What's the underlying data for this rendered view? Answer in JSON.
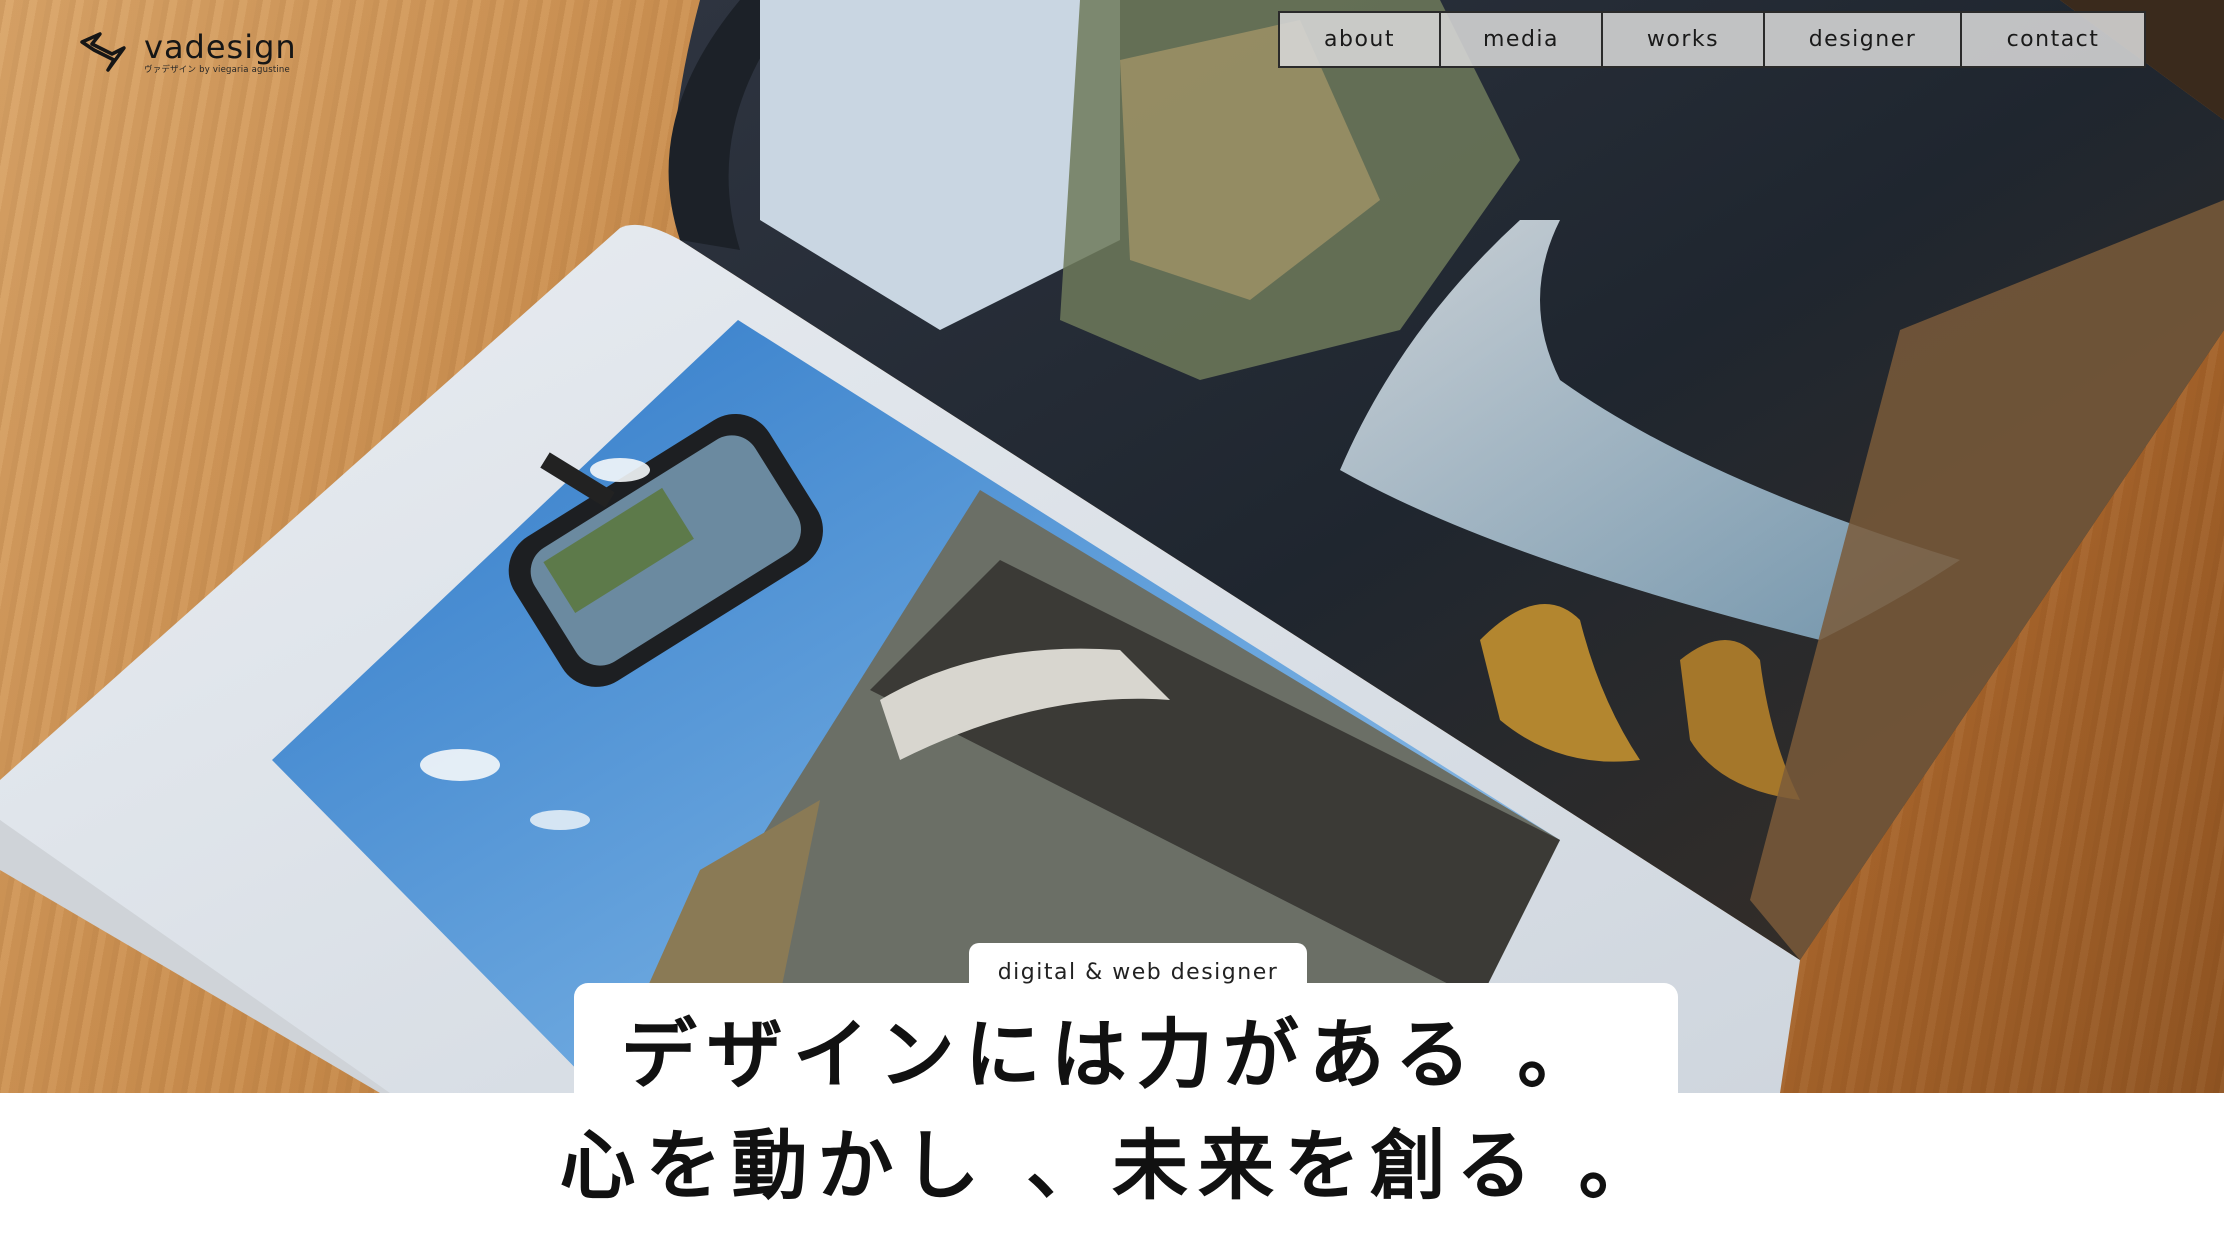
{
  "brand": {
    "name": "vadesign",
    "subtitle": "ヴァデザイン by viegaria agustine",
    "logo_icon": "vadesign-logo-mark"
  },
  "nav": {
    "items": [
      {
        "label": "about"
      },
      {
        "label": "media"
      },
      {
        "label": "works"
      },
      {
        "label": "designer"
      },
      {
        "label": "contact"
      }
    ]
  },
  "hero": {
    "tagline": "digital & web designer",
    "headline_line1": "デザインには力がある 。",
    "headline_line2": "心を動かし 、未来を創る 。"
  },
  "colors": {
    "nav_bg": "#d7d7d7",
    "nav_border": "#2a2a2a",
    "text": "#111111",
    "wood": "#c98d4e"
  }
}
